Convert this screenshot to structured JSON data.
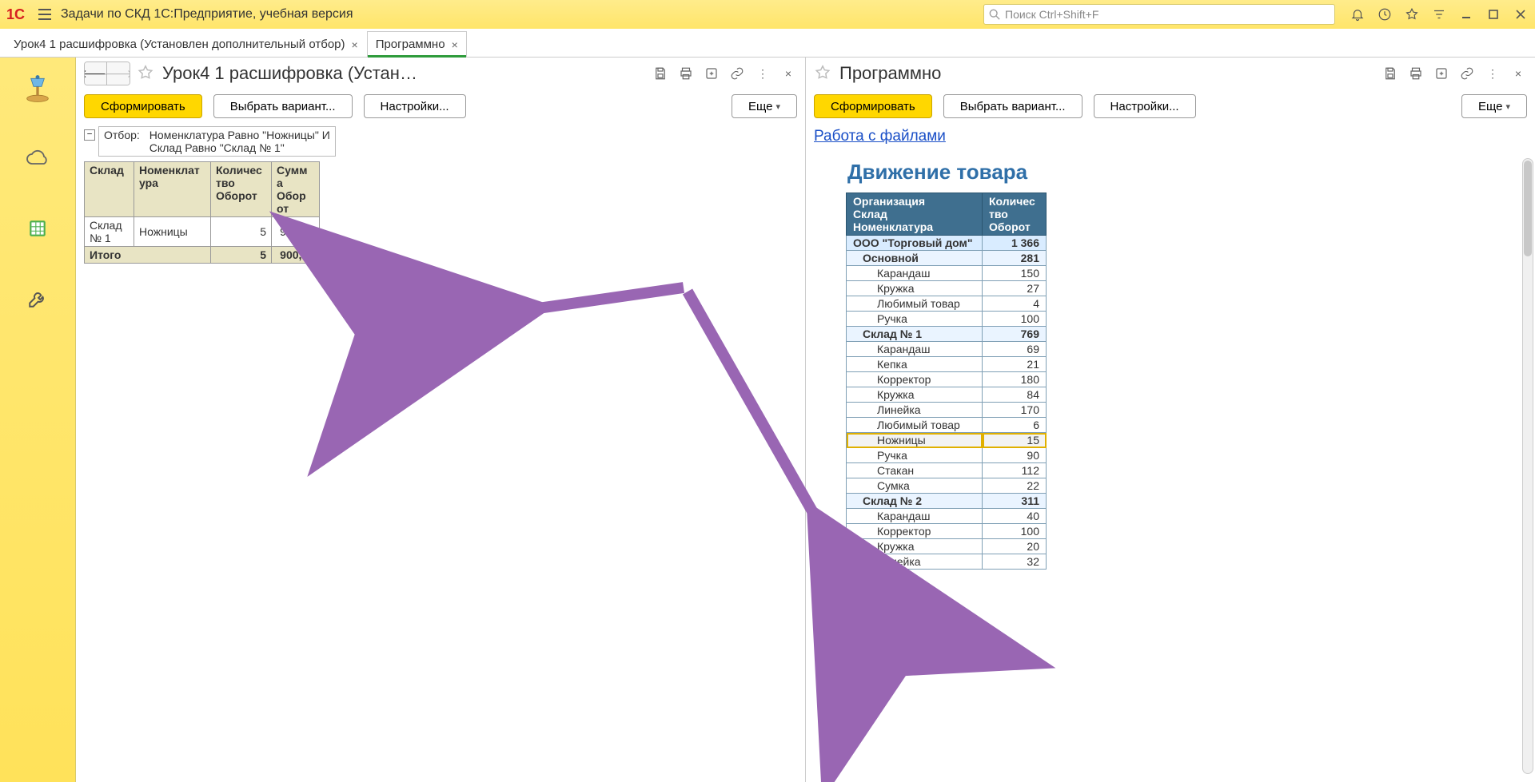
{
  "titlebar": {
    "app_title": "Задачи по СКД 1С:Предприятие, учебная версия",
    "search_placeholder": "Поиск Ctrl+Shift+F"
  },
  "tabs": [
    {
      "label": "Урок4 1 расшифровка (Установлен дополнительный отбор)",
      "active": false
    },
    {
      "label": "Программно",
      "active": true
    }
  ],
  "left_pane": {
    "title": "Урок4 1 расшифровка (Устан…",
    "buttons": {
      "run": "Сформировать",
      "variant": "Выбрать вариант...",
      "settings": "Настройки...",
      "more": "Еще"
    },
    "filter_label": "Отбор:",
    "filter_lines": [
      "Номенклатура Равно \"Ножницы\" И",
      "Склад Равно \"Склад № 1\""
    ],
    "headers": [
      "Склад",
      "Номенклатура",
      "Количество Оборот",
      "Сумма Оборот"
    ],
    "rows": [
      {
        "sklad": "Склад № 1",
        "nomen": "Ножницы",
        "qty": "5",
        "sum": "900,00"
      }
    ],
    "total_label": "Итого",
    "total_qty": "5",
    "total_sum": "900,00"
  },
  "right_pane": {
    "title": "Программно",
    "buttons": {
      "run": "Сформировать",
      "variant": "Выбрать вариант...",
      "settings": "Настройки...",
      "more": "Еще"
    },
    "link": "Работа с файлами",
    "report_title": "Движение товара",
    "header_left_lines": [
      "Организация",
      "Склад",
      "Номенклатура"
    ],
    "header_right_lines": [
      "Количество",
      "Оборот"
    ],
    "data": [
      {
        "lvl": 0,
        "name": "ООО \"Торговый дом\"",
        "val": "1 366"
      },
      {
        "lvl": 1,
        "name": "Основной",
        "val": "281"
      },
      {
        "lvl": 2,
        "name": "Карандаш",
        "val": "150"
      },
      {
        "lvl": 2,
        "name": "Кружка",
        "val": "27"
      },
      {
        "lvl": 2,
        "name": "Любимый товар",
        "val": "4"
      },
      {
        "lvl": 2,
        "name": "Ручка",
        "val": "100"
      },
      {
        "lvl": 1,
        "name": "Склад № 1",
        "val": "769"
      },
      {
        "lvl": 2,
        "name": "Карандаш",
        "val": "69"
      },
      {
        "lvl": 2,
        "name": "Кепка",
        "val": "21"
      },
      {
        "lvl": 2,
        "name": "Корректор",
        "val": "180"
      },
      {
        "lvl": 2,
        "name": "Кружка",
        "val": "84"
      },
      {
        "lvl": 2,
        "name": "Линейка",
        "val": "170"
      },
      {
        "lvl": 2,
        "name": "Любимый товар",
        "val": "6"
      },
      {
        "lvl": 2,
        "name": "Ножницы",
        "val": "15",
        "sel": true
      },
      {
        "lvl": 2,
        "name": "Ручка",
        "val": "90"
      },
      {
        "lvl": 2,
        "name": "Стакан",
        "val": "112"
      },
      {
        "lvl": 2,
        "name": "Сумка",
        "val": "22"
      },
      {
        "lvl": 1,
        "name": "Склад № 2",
        "val": "311"
      },
      {
        "lvl": 2,
        "name": "Карандаш",
        "val": "40"
      },
      {
        "lvl": 2,
        "name": "Корректор",
        "val": "100"
      },
      {
        "lvl": 2,
        "name": "Кружка",
        "val": "20"
      },
      {
        "lvl": 2,
        "name": "Линейка",
        "val": "32"
      }
    ]
  }
}
